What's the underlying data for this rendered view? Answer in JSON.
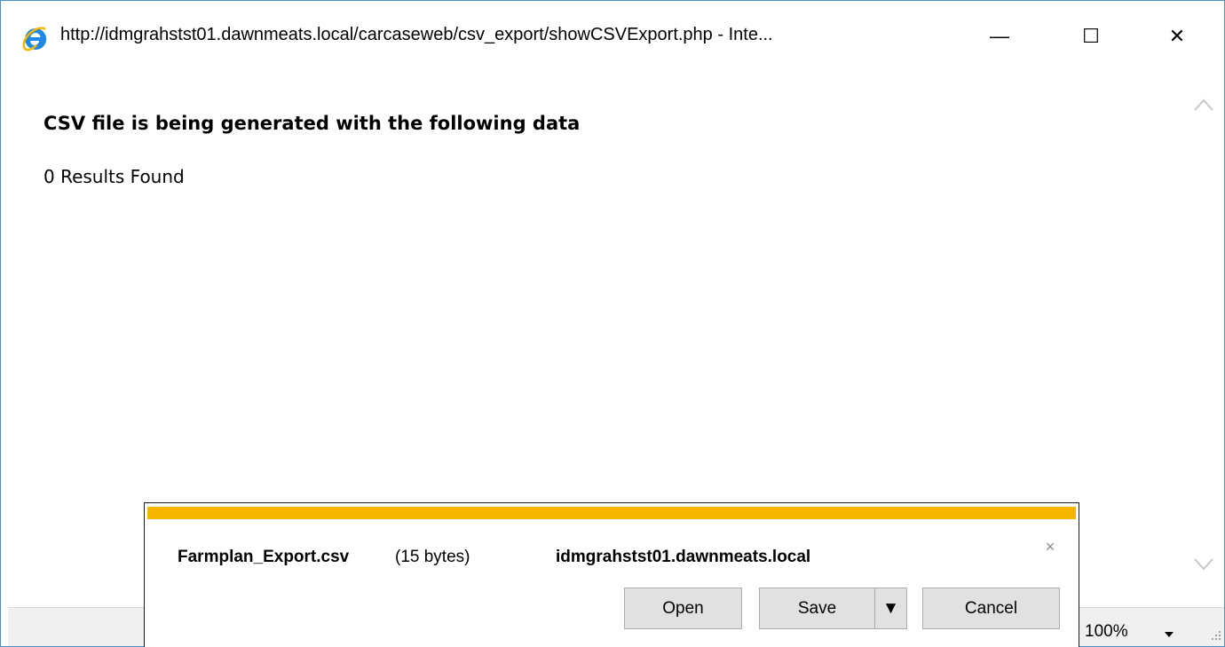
{
  "window": {
    "title": "http://idmgrahstst01.dawnmeats.local/carcaseweb/csv_export/showCSVExport.php - Inte...",
    "controls": {
      "minimize": "—",
      "maximize": "☐",
      "close": "✕"
    }
  },
  "page": {
    "heading": "CSV file is being generated with the following data",
    "results": "0 Results Found"
  },
  "statusbar": {
    "zoom": "100%"
  },
  "download_bar": {
    "file_name": "Farmplan_Export.csv",
    "file_size": "(15 bytes)",
    "host": "idmgrahstst01.dawnmeats.local",
    "close": "×",
    "buttons": {
      "open": "Open",
      "save": "Save",
      "save_menu": "▼",
      "cancel": "Cancel"
    }
  },
  "colors": {
    "accent": "#f4b400",
    "window_border": "#4f8fc2",
    "ie_blue": "#1e88e5"
  },
  "icons": [
    "internet-explorer-icon",
    "scroll-up-icon",
    "scroll-down-icon",
    "chevron-down-icon",
    "resize-grip-icon"
  ]
}
